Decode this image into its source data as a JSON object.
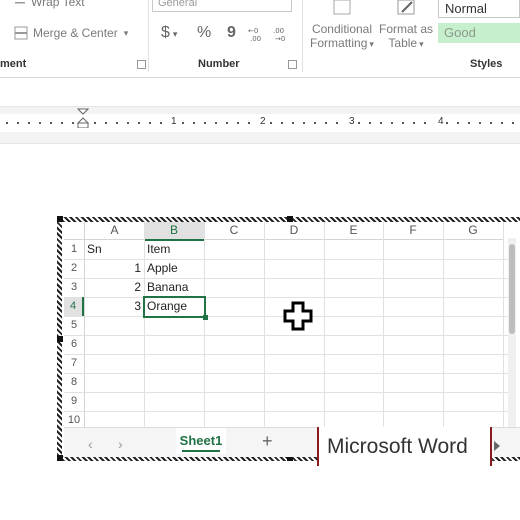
{
  "ribbon": {
    "wrap_text_label": "Wrap Text",
    "merge_center_label": "Merge & Center",
    "alignment_group_label": "ment",
    "number_format_value": "General",
    "currency_symbol": "$",
    "percent_symbol": "%",
    "comma_symbol": "9",
    "number_group_label": "Number",
    "conditional_formatting_label_1": "Conditional",
    "conditional_formatting_label_2": "Formatting",
    "format_as_table_label_1": "Format as",
    "format_as_table_label_2": "Table",
    "style_normal": "Normal",
    "style_good": "Good",
    "styles_group_label": "Styles",
    "colors": {
      "good_bg": "#c6efce",
      "good_text": "#8a9a8a"
    }
  },
  "ruler": {
    "numbers": [
      "1",
      "2",
      "3",
      "4"
    ]
  },
  "spreadsheet": {
    "columns": [
      "A",
      "B",
      "C",
      "D",
      "E",
      "F",
      "G"
    ],
    "rows": [
      "1",
      "2",
      "3",
      "4",
      "5",
      "6",
      "7",
      "8",
      "9",
      "10"
    ],
    "cells": {
      "A1": "Sn",
      "B1": "Item",
      "A2": "1",
      "B2": "Apple",
      "A3": "2",
      "B3": "Banana",
      "A4": "3",
      "B4": "Orange"
    },
    "selected_cell": "B4",
    "sheet_tab": "Sheet1",
    "add_sheet": "+",
    "nav_prev": "‹",
    "nav_next": "›",
    "accent": "#217346"
  },
  "tooltip": {
    "text": "Microsoft Word"
  }
}
